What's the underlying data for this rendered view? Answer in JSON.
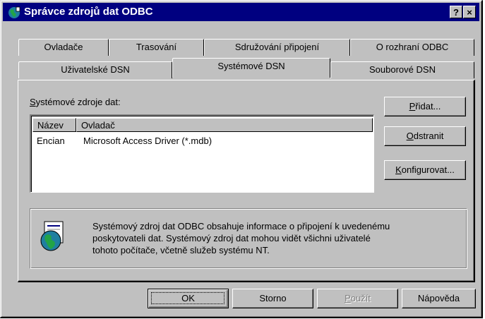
{
  "window": {
    "title": "Správce zdrojů dat ODBC",
    "help_label": "?",
    "close_label": "×"
  },
  "tabs": {
    "row_back": [
      {
        "label": "Ovladače"
      },
      {
        "label": "Trasování"
      },
      {
        "label": "Sdružování připojení"
      },
      {
        "label": "O rozhraní ODBC"
      }
    ],
    "row_front": [
      {
        "label": "Uživatelské DSN"
      },
      {
        "label": "Systémové DSN",
        "active": true
      },
      {
        "label": "Souborové DSN"
      }
    ]
  },
  "panel": {
    "group_label_first": "S",
    "group_label_rest": "ystémové zdroje dat:",
    "list": {
      "columns": [
        "Název",
        "Ovladač"
      ],
      "rows": [
        [
          "Encian",
          "Microsoft Access Driver (*.mdb)"
        ]
      ]
    },
    "buttons": {
      "add": {
        "mn": "P",
        "rest": "řidat..."
      },
      "remove": {
        "mn": "O",
        "rest": "dstranit"
      },
      "configure": {
        "mn": "K",
        "rest": "onfigurovat..."
      }
    },
    "info": {
      "line1": "Systémový zdroj dat ODBC obsahuje informace o připojení k uvedenému",
      "line2": "poskytovateli dat. Systémový zdroj dat mohou vidět všichni uživatelé",
      "line3": "tohoto počítače, včetně služeb systému NT."
    }
  },
  "footer": {
    "ok": "OK",
    "cancel": "Storno",
    "apply_mn": "P",
    "apply_rest": "oužít",
    "help": "Nápověda"
  },
  "colors": {
    "titlebar": "#000080",
    "face": "#c0c0c0",
    "shadow": "#808080",
    "highlight": "#ffffff"
  },
  "icons": {
    "title": "globe-icon",
    "info": "data-source-globe-icon"
  }
}
